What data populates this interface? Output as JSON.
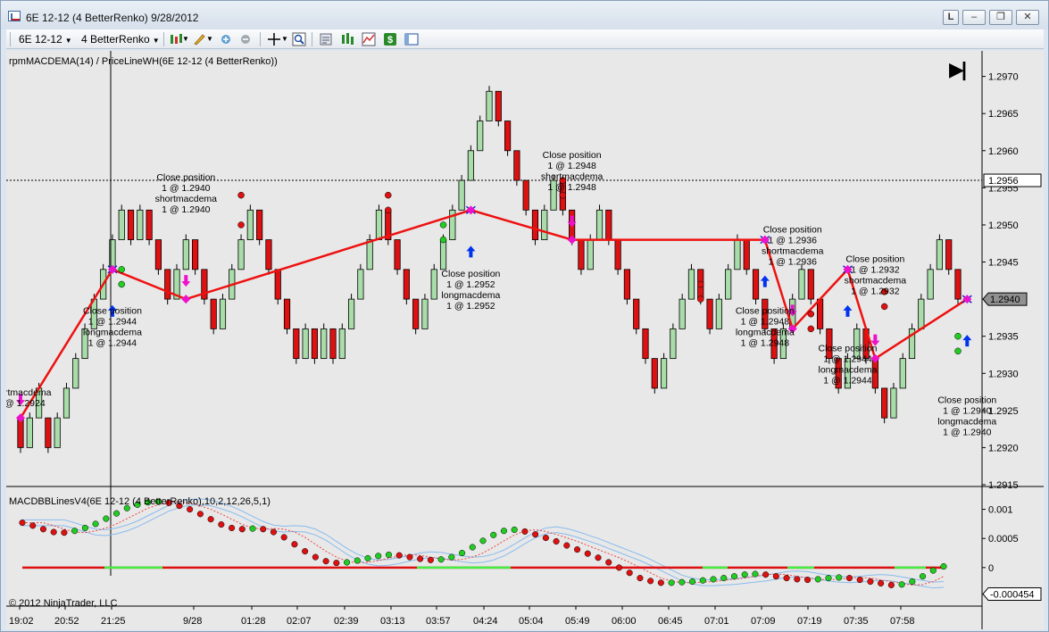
{
  "window": {
    "title": "6E 12-12 (4 BetterRenko)  9/28/2012",
    "buttons": [
      "L",
      "–",
      "❐",
      "✕"
    ]
  },
  "toolbar": {
    "instrument": "6E 12-12",
    "bar_type": "4 BetterRenko",
    "icons": [
      "bar-type-icon",
      "drawing-pencil-icon",
      "strategy-add-icon",
      "strategy-remove-icon",
      "crosshair-icon",
      "zoom-icon",
      "data-box-icon",
      "bars-icon",
      "indicators-icon",
      "dollar-icon",
      "properties-icon"
    ]
  },
  "price_panel": {
    "label": "rpmMACDEMA(14) / PriceLineWH(6E 12-12 (4 BetterRenko))",
    "current_price_label": "1.2940",
    "marker_price_label": "1.2956",
    "y_ticks": [
      "1.2970",
      "1.2965",
      "1.2960",
      "1.2955",
      "1.2950",
      "1.2945",
      "1.2940",
      "1.2935",
      "1.2930",
      "1.2925",
      "1.2920",
      "1.2915"
    ],
    "annotations": [
      {
        "lines": [
          "rtmacdema",
          "@ 1.2924"
        ],
        "at": "left"
      },
      {
        "lines": [
          "Close position",
          "1 @ 1.2944",
          "longmacdema",
          "1 @ 1.2944"
        ]
      },
      {
        "lines": [
          "Close position",
          "1 @ 1.2940",
          "shortmacdema",
          "1 @ 1.2940"
        ]
      },
      {
        "lines": [
          "Close position",
          "1 @ 1.2952",
          "longmacdema",
          "1 @ 1.2952"
        ]
      },
      {
        "lines": [
          "Close position",
          "1 @ 1.2948",
          "shortmacdema",
          "1 @ 1.2948"
        ]
      },
      {
        "lines": [
          "Close position",
          "1 @ 1.2948",
          "longmacdema",
          "1 @ 1.2948"
        ]
      },
      {
        "lines": [
          "Close position",
          "1 @ 1.2936",
          "shortmacdema",
          "1 @ 1.2936"
        ]
      },
      {
        "lines": [
          "Close position",
          "1 @ 1.2944",
          "longmacdema",
          "1 @ 1.2944"
        ]
      },
      {
        "lines": [
          "Close position",
          "1 @ 1.2932",
          "shortmacdema",
          "1 @ 1.2932"
        ]
      },
      {
        "lines": [
          "Close position",
          "1 @ 1.2940",
          "longmacdema",
          "1 @ 1.2940"
        ]
      }
    ]
  },
  "indicator_panel": {
    "label": "MACDBBLinesV4(6E 12-12 (4 BetterRenko),10,2,12,26,5,1)",
    "y_ticks": [
      "0.001",
      "0.0005",
      "0"
    ],
    "current_value_label": "-0.000454"
  },
  "x_ticks": [
    "19:02",
    "20:52",
    "21:25",
    "9/28",
    "01:28",
    "02:07",
    "02:39",
    "03:13",
    "03:57",
    "04:24",
    "05:04",
    "05:49",
    "06:00",
    "06:45",
    "07:01",
    "07:09",
    "07:19",
    "07:35",
    "07:58"
  ],
  "copyright": "© 2012 NinjaTrader, LLC",
  "colors": {
    "up_bar": "#a8dca8",
    "down_bar": "#dd1111",
    "trade_line": "#ee1111",
    "buy_arrow": "#0033ee",
    "sell_arrow": "#ee11cc",
    "background": "#e8e8e8"
  },
  "chart_data": [
    {
      "type": "candlestick",
      "title": "rpmMACDEMA(14) / PriceLineWH(6E 12-12 (4 BetterRenko))",
      "y_range": [
        1.2915,
        1.2972
      ],
      "renko_brick": 0.0004,
      "bricks": [
        {
          "open": 1.2924,
          "close": 1.292
        },
        {
          "open": 1.292,
          "close": 1.2924
        },
        {
          "open": 1.2924,
          "close": 1.2928
        },
        {
          "open": 1.2924,
          "close": 1.292
        },
        {
          "open": 1.292,
          "close": 1.2924
        },
        {
          "open": 1.2924,
          "close": 1.2928
        },
        {
          "open": 1.2928,
          "close": 1.2932
        },
        {
          "open": 1.2932,
          "close": 1.2936
        },
        {
          "open": 1.2936,
          "close": 1.294
        },
        {
          "open": 1.294,
          "close": 1.2944
        },
        {
          "open": 1.2944,
          "close": 1.2948
        },
        {
          "open": 1.2948,
          "close": 1.2952
        },
        {
          "open": 1.2952,
          "close": 1.2948
        },
        {
          "open": 1.2948,
          "close": 1.2952
        },
        {
          "open": 1.2952,
          "close": 1.2948
        },
        {
          "open": 1.2948,
          "close": 1.2944
        },
        {
          "open": 1.2944,
          "close": 1.294
        },
        {
          "open": 1.294,
          "close": 1.2944
        },
        {
          "open": 1.2944,
          "close": 1.2948
        },
        {
          "open": 1.2948,
          "close": 1.2944
        },
        {
          "open": 1.2944,
          "close": 1.294
        },
        {
          "open": 1.294,
          "close": 1.2936
        },
        {
          "open": 1.2936,
          "close": 1.294
        },
        {
          "open": 1.294,
          "close": 1.2944
        },
        {
          "open": 1.2944,
          "close": 1.2948
        },
        {
          "open": 1.2948,
          "close": 1.2952
        },
        {
          "open": 1.2952,
          "close": 1.2948
        },
        {
          "open": 1.2948,
          "close": 1.2944
        },
        {
          "open": 1.2944,
          "close": 1.294
        },
        {
          "open": 1.294,
          "close": 1.2936
        },
        {
          "open": 1.2936,
          "close": 1.2932
        },
        {
          "open": 1.2932,
          "close": 1.2936
        },
        {
          "open": 1.2936,
          "close": 1.2932
        },
        {
          "open": 1.2932,
          "close": 1.2936
        },
        {
          "open": 1.2936,
          "close": 1.2932
        },
        {
          "open": 1.2932,
          "close": 1.2936
        },
        {
          "open": 1.2936,
          "close": 1.294
        },
        {
          "open": 1.294,
          "close": 1.2944
        },
        {
          "open": 1.2944,
          "close": 1.2948
        },
        {
          "open": 1.2948,
          "close": 1.2952
        },
        {
          "open": 1.2952,
          "close": 1.2948
        },
        {
          "open": 1.2948,
          "close": 1.2944
        },
        {
          "open": 1.2944,
          "close": 1.294
        },
        {
          "open": 1.294,
          "close": 1.2936
        },
        {
          "open": 1.2936,
          "close": 1.294
        },
        {
          "open": 1.294,
          "close": 1.2944
        },
        {
          "open": 1.2944,
          "close": 1.2948
        },
        {
          "open": 1.2948,
          "close": 1.2952
        },
        {
          "open": 1.2952,
          "close": 1.2956
        },
        {
          "open": 1.2956,
          "close": 1.296
        },
        {
          "open": 1.296,
          "close": 1.2964
        },
        {
          "open": 1.2964,
          "close": 1.2968
        },
        {
          "open": 1.2968,
          "close": 1.2964
        },
        {
          "open": 1.2964,
          "close": 1.296
        },
        {
          "open": 1.296,
          "close": 1.2956
        },
        {
          "open": 1.2956,
          "close": 1.2952
        },
        {
          "open": 1.2952,
          "close": 1.2948
        },
        {
          "open": 1.2948,
          "close": 1.2952
        },
        {
          "open": 1.2952,
          "close": 1.2956
        },
        {
          "open": 1.2956,
          "close": 1.2952
        },
        {
          "open": 1.2952,
          "close": 1.2948
        },
        {
          "open": 1.2948,
          "close": 1.2944
        },
        {
          "open": 1.2944,
          "close": 1.2948
        },
        {
          "open": 1.2948,
          "close": 1.2952
        },
        {
          "open": 1.2952,
          "close": 1.2948
        },
        {
          "open": 1.2948,
          "close": 1.2944
        },
        {
          "open": 1.2944,
          "close": 1.294
        },
        {
          "open": 1.294,
          "close": 1.2936
        },
        {
          "open": 1.2936,
          "close": 1.2932
        },
        {
          "open": 1.2932,
          "close": 1.2928
        },
        {
          "open": 1.2928,
          "close": 1.2932
        },
        {
          "open": 1.2932,
          "close": 1.2936
        },
        {
          "open": 1.2936,
          "close": 1.294
        },
        {
          "open": 1.294,
          "close": 1.2944
        },
        {
          "open": 1.2944,
          "close": 1.294
        },
        {
          "open": 1.294,
          "close": 1.2936
        },
        {
          "open": 1.2936,
          "close": 1.294
        },
        {
          "open": 1.294,
          "close": 1.2944
        },
        {
          "open": 1.2944,
          "close": 1.2948
        },
        {
          "open": 1.2948,
          "close": 1.2944
        },
        {
          "open": 1.2944,
          "close": 1.294
        },
        {
          "open": 1.294,
          "close": 1.2936
        },
        {
          "open": 1.2936,
          "close": 1.2932
        },
        {
          "open": 1.2932,
          "close": 1.2936
        },
        {
          "open": 1.2936,
          "close": 1.294
        },
        {
          "open": 1.294,
          "close": 1.2944
        },
        {
          "open": 1.2944,
          "close": 1.294
        },
        {
          "open": 1.294,
          "close": 1.2936
        },
        {
          "open": 1.2936,
          "close": 1.2932
        },
        {
          "open": 1.2932,
          "close": 1.2928
        },
        {
          "open": 1.2928,
          "close": 1.2932
        },
        {
          "open": 1.2932,
          "close": 1.2936
        },
        {
          "open": 1.2936,
          "close": 1.2932
        },
        {
          "open": 1.2932,
          "close": 1.2928
        },
        {
          "open": 1.2928,
          "close": 1.2924
        },
        {
          "open": 1.2924,
          "close": 1.2928
        },
        {
          "open": 1.2928,
          "close": 1.2932
        },
        {
          "open": 1.2932,
          "close": 1.2936
        },
        {
          "open": 1.2936,
          "close": 1.294
        },
        {
          "open": 1.294,
          "close": 1.2944
        },
        {
          "open": 1.2944,
          "close": 1.2948
        },
        {
          "open": 1.2948,
          "close": 1.2944
        },
        {
          "open": 1.2944,
          "close": 1.294
        }
      ],
      "trade_path": [
        {
          "bar": 0,
          "price": 1.2924
        },
        {
          "bar": 10,
          "price": 1.2944
        },
        {
          "bar": 18,
          "price": 1.294
        },
        {
          "bar": 49,
          "price": 1.2952
        },
        {
          "bar": 60,
          "price": 1.2948
        },
        {
          "bar": 81,
          "price": 1.2948
        },
        {
          "bar": 84,
          "price": 1.2936
        },
        {
          "bar": 90,
          "price": 1.2944
        },
        {
          "bar": 93,
          "price": 1.2932
        },
        {
          "bar": 103,
          "price": 1.294
        }
      ]
    },
    {
      "type": "line",
      "title": "MACDBBLinesV4(6E 12-12 (4 BetterRenko),10,2,12,26,5,1)",
      "y_range": [
        -0.0006,
        0.0013
      ],
      "series": [
        {
          "name": "MACD",
          "values": [
            0.00077,
            0.00072,
            0.00066,
            0.00061,
            0.0006,
            0.00063,
            0.00068,
            0.00075,
            0.00084,
            0.00093,
            0.00102,
            0.00108,
            0.00112,
            0.00113,
            0.00111,
            0.00106,
            0.001,
            0.00092,
            0.00083,
            0.00074,
            0.00068,
            0.00066,
            0.00067,
            0.00066,
            0.00061,
            0.00052,
            0.0004,
            0.00028,
            0.00018,
            0.00011,
            8e-05,
            9e-05,
            0.00012,
            0.00016,
            0.0002,
            0.00022,
            0.00021,
            0.00018,
            0.00015,
            0.00013,
            0.00014,
            0.00018,
            0.00025,
            0.00035,
            0.00046,
            0.00056,
            0.00063,
            0.00065,
            0.00062,
            0.00057,
            0.00051,
            0.00045,
            0.00038,
            0.00031,
            0.00024,
            0.00017,
            9e-05,
            0.0,
            -9e-05,
            -0.00018,
            -0.00023,
            -0.00026,
            -0.00026,
            -0.00025,
            -0.00024,
            -0.00022,
            -0.0002,
            -0.00018,
            -0.00015,
            -0.00012,
            -0.00011,
            -0.00012,
            -0.00015,
            -0.00018,
            -0.0002,
            -0.00021,
            -0.0002,
            -0.00018,
            -0.00017,
            -0.00018,
            -0.00021,
            -0.00024,
            -0.00027,
            -0.0003,
            -0.00029,
            -0.00024,
            -0.00015,
            -5e-05,
            2e-05
          ]
        }
      ]
    }
  ]
}
